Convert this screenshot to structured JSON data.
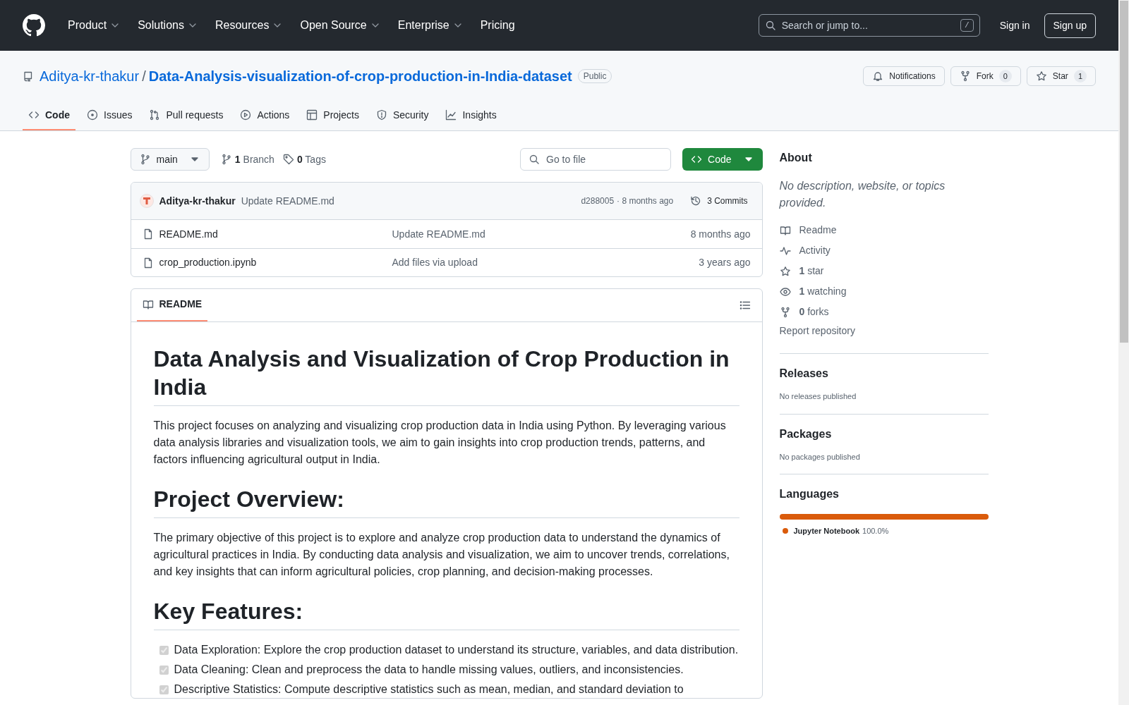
{
  "header": {
    "nav": [
      {
        "label": "Product",
        "dropdown": true
      },
      {
        "label": "Solutions",
        "dropdown": true
      },
      {
        "label": "Resources",
        "dropdown": true
      },
      {
        "label": "Open Source",
        "dropdown": true
      },
      {
        "label": "Enterprise",
        "dropdown": true
      },
      {
        "label": "Pricing",
        "dropdown": false
      }
    ],
    "search_placeholder": "Search or jump to...",
    "search_key": "/",
    "sign_in": "Sign in",
    "sign_up": "Sign up"
  },
  "repo": {
    "owner": "Aditya-kr-thakur",
    "separator": "/",
    "name": "Data-Analysis-visualization-of-crop-production-in-India-dataset",
    "visibility": "Public",
    "notifications": "Notifications",
    "fork": {
      "label": "Fork",
      "count": "0"
    },
    "star": {
      "label": "Star",
      "count": "1"
    }
  },
  "tabs": [
    {
      "label": "Code",
      "kind": "code",
      "selected": true
    },
    {
      "label": "Issues",
      "kind": "issues",
      "selected": false
    },
    {
      "label": "Pull requests",
      "kind": "pulls",
      "selected": false
    },
    {
      "label": "Actions",
      "kind": "actions",
      "selected": false
    },
    {
      "label": "Projects",
      "kind": "projects",
      "selected": false
    },
    {
      "label": "Security",
      "kind": "security",
      "selected": false
    },
    {
      "label": "Insights",
      "kind": "insights",
      "selected": false
    }
  ],
  "toolbar": {
    "branch": "main",
    "branches": {
      "count": "1",
      "label": "Branch"
    },
    "tags": {
      "count": "0",
      "label": "Tags"
    },
    "file_search": {
      "placeholder": "Go to file"
    },
    "code_button": "Code"
  },
  "commit": {
    "author": "Aditya-kr-thakur",
    "message": "Update README.md",
    "hash": "d288005",
    "time": "· 8 months ago",
    "commits": "3 Commits"
  },
  "files": [
    {
      "name": "README.md",
      "message": "Update README.md",
      "time": "8 months ago"
    },
    {
      "name": "crop_production.ipynb",
      "message": "Add files via upload",
      "time": "3 years ago"
    }
  ],
  "readme": {
    "tab": "README",
    "blocks": [
      {
        "kind": "h1",
        "text": "Data Analysis and Visualization of Crop Production in India"
      },
      {
        "kind": "p",
        "text": "This project focuses on analyzing and visualizing crop production data in India using Python. By leveraging various data analysis libraries and visualization tools, we aim to gain insights into crop production trends, patterns, and factors influencing agricultural output in India."
      },
      {
        "kind": "h1",
        "text": "Project Overview:"
      },
      {
        "kind": "p",
        "text": "The primary objective of this project is to explore and analyze crop production data to understand the dynamics of agricultural practices in India. By conducting data analysis and visualization, we aim to uncover trends, correlations, and key insights that can inform agricultural policies, crop planning, and decision-making processes."
      },
      {
        "kind": "h1",
        "text": "Key Features:"
      },
      {
        "kind": "tasklist",
        "items": [
          {
            "text": "Data Exploration: Explore the crop production dataset to understand its structure, variables, and data distribution.",
            "checked": true
          },
          {
            "text": "Data Cleaning: Clean and preprocess the data to handle missing values, outliers, and inconsistencies.",
            "checked": true
          },
          {
            "text": "Descriptive Statistics: Compute descriptive statistics such as mean, median, and standard deviation to",
            "checked": true
          }
        ]
      }
    ]
  },
  "about": {
    "heading": "About",
    "description": "No description, website, or topics provided.",
    "links": [
      {
        "kind": "readme",
        "label": "Readme"
      },
      {
        "kind": "activity",
        "label": "Activity"
      },
      {
        "kind": "star",
        "count": "1",
        "label": "star"
      },
      {
        "kind": "watch",
        "count": "1",
        "label": "watching"
      },
      {
        "kind": "fork",
        "count": "0",
        "label": "forks"
      }
    ],
    "report": "Report repository"
  },
  "releases": {
    "heading": "Releases",
    "note": "No releases published"
  },
  "packages": {
    "heading": "Packages",
    "note": "No packages published"
  },
  "languages": {
    "heading": "Languages",
    "items": [
      {
        "name": "Jupyter Notebook",
        "percent": "100.0%",
        "color": "#da5b0b",
        "level": 1
      }
    ]
  }
}
